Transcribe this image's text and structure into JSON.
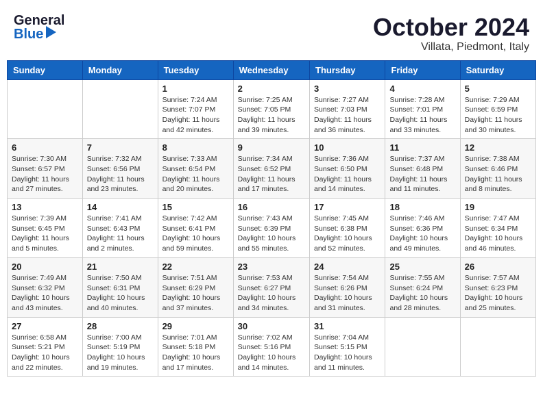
{
  "header": {
    "logo_general": "General",
    "logo_blue": "Blue",
    "month_title": "October 2024",
    "location": "Villata, Piedmont, Italy"
  },
  "calendar": {
    "days_of_week": [
      "Sunday",
      "Monday",
      "Tuesday",
      "Wednesday",
      "Thursday",
      "Friday",
      "Saturday"
    ],
    "weeks": [
      [
        {
          "day": "",
          "info": ""
        },
        {
          "day": "",
          "info": ""
        },
        {
          "day": "1",
          "info": "Sunrise: 7:24 AM\nSunset: 7:07 PM\nDaylight: 11 hours\nand 42 minutes."
        },
        {
          "day": "2",
          "info": "Sunrise: 7:25 AM\nSunset: 7:05 PM\nDaylight: 11 hours\nand 39 minutes."
        },
        {
          "day": "3",
          "info": "Sunrise: 7:27 AM\nSunset: 7:03 PM\nDaylight: 11 hours\nand 36 minutes."
        },
        {
          "day": "4",
          "info": "Sunrise: 7:28 AM\nSunset: 7:01 PM\nDaylight: 11 hours\nand 33 minutes."
        },
        {
          "day": "5",
          "info": "Sunrise: 7:29 AM\nSunset: 6:59 PM\nDaylight: 11 hours\nand 30 minutes."
        }
      ],
      [
        {
          "day": "6",
          "info": "Sunrise: 7:30 AM\nSunset: 6:57 PM\nDaylight: 11 hours\nand 27 minutes."
        },
        {
          "day": "7",
          "info": "Sunrise: 7:32 AM\nSunset: 6:56 PM\nDaylight: 11 hours\nand 23 minutes."
        },
        {
          "day": "8",
          "info": "Sunrise: 7:33 AM\nSunset: 6:54 PM\nDaylight: 11 hours\nand 20 minutes."
        },
        {
          "day": "9",
          "info": "Sunrise: 7:34 AM\nSunset: 6:52 PM\nDaylight: 11 hours\nand 17 minutes."
        },
        {
          "day": "10",
          "info": "Sunrise: 7:36 AM\nSunset: 6:50 PM\nDaylight: 11 hours\nand 14 minutes."
        },
        {
          "day": "11",
          "info": "Sunrise: 7:37 AM\nSunset: 6:48 PM\nDaylight: 11 hours\nand 11 minutes."
        },
        {
          "day": "12",
          "info": "Sunrise: 7:38 AM\nSunset: 6:46 PM\nDaylight: 11 hours\nand 8 minutes."
        }
      ],
      [
        {
          "day": "13",
          "info": "Sunrise: 7:39 AM\nSunset: 6:45 PM\nDaylight: 11 hours\nand 5 minutes."
        },
        {
          "day": "14",
          "info": "Sunrise: 7:41 AM\nSunset: 6:43 PM\nDaylight: 11 hours\nand 2 minutes."
        },
        {
          "day": "15",
          "info": "Sunrise: 7:42 AM\nSunset: 6:41 PM\nDaylight: 10 hours\nand 59 minutes."
        },
        {
          "day": "16",
          "info": "Sunrise: 7:43 AM\nSunset: 6:39 PM\nDaylight: 10 hours\nand 55 minutes."
        },
        {
          "day": "17",
          "info": "Sunrise: 7:45 AM\nSunset: 6:38 PM\nDaylight: 10 hours\nand 52 minutes."
        },
        {
          "day": "18",
          "info": "Sunrise: 7:46 AM\nSunset: 6:36 PM\nDaylight: 10 hours\nand 49 minutes."
        },
        {
          "day": "19",
          "info": "Sunrise: 7:47 AM\nSunset: 6:34 PM\nDaylight: 10 hours\nand 46 minutes."
        }
      ],
      [
        {
          "day": "20",
          "info": "Sunrise: 7:49 AM\nSunset: 6:32 PM\nDaylight: 10 hours\nand 43 minutes."
        },
        {
          "day": "21",
          "info": "Sunrise: 7:50 AM\nSunset: 6:31 PM\nDaylight: 10 hours\nand 40 minutes."
        },
        {
          "day": "22",
          "info": "Sunrise: 7:51 AM\nSunset: 6:29 PM\nDaylight: 10 hours\nand 37 minutes."
        },
        {
          "day": "23",
          "info": "Sunrise: 7:53 AM\nSunset: 6:27 PM\nDaylight: 10 hours\nand 34 minutes."
        },
        {
          "day": "24",
          "info": "Sunrise: 7:54 AM\nSunset: 6:26 PM\nDaylight: 10 hours\nand 31 minutes."
        },
        {
          "day": "25",
          "info": "Sunrise: 7:55 AM\nSunset: 6:24 PM\nDaylight: 10 hours\nand 28 minutes."
        },
        {
          "day": "26",
          "info": "Sunrise: 7:57 AM\nSunset: 6:23 PM\nDaylight: 10 hours\nand 25 minutes."
        }
      ],
      [
        {
          "day": "27",
          "info": "Sunrise: 6:58 AM\nSunset: 5:21 PM\nDaylight: 10 hours\nand 22 minutes."
        },
        {
          "day": "28",
          "info": "Sunrise: 7:00 AM\nSunset: 5:19 PM\nDaylight: 10 hours\nand 19 minutes."
        },
        {
          "day": "29",
          "info": "Sunrise: 7:01 AM\nSunset: 5:18 PM\nDaylight: 10 hours\nand 17 minutes."
        },
        {
          "day": "30",
          "info": "Sunrise: 7:02 AM\nSunset: 5:16 PM\nDaylight: 10 hours\nand 14 minutes."
        },
        {
          "day": "31",
          "info": "Sunrise: 7:04 AM\nSunset: 5:15 PM\nDaylight: 10 hours\nand 11 minutes."
        },
        {
          "day": "",
          "info": ""
        },
        {
          "day": "",
          "info": ""
        }
      ]
    ]
  }
}
